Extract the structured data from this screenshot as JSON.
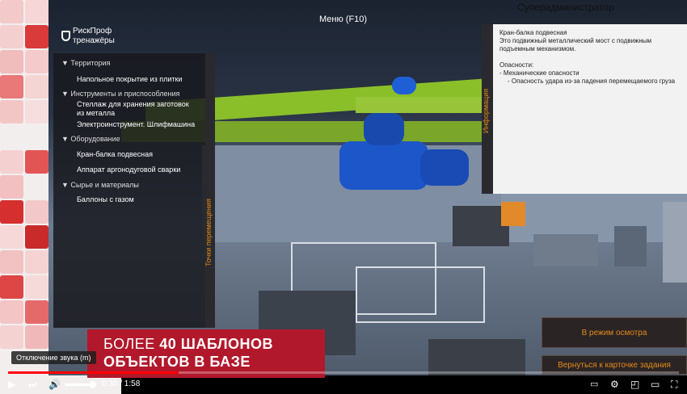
{
  "topbar": {
    "menu_label": "Меню (F10)",
    "admin_label": "Суперадминистратор"
  },
  "logo": {
    "line1": "РискПроф",
    "line2": "тренажёры"
  },
  "left_panel": {
    "strip_label": "Точки перемещения",
    "categories": [
      {
        "label": "Территория",
        "items": [
          "Напольное покрытие из плитки"
        ]
      },
      {
        "label": "Инструменты и приспособления",
        "items": [
          "Стеллаж для хранения заготовок из металла",
          "Электроинструмент. Шлифмашина"
        ]
      },
      {
        "label": "Оборудование",
        "items": [
          "Кран-балка подвесная",
          "Аппарат аргонодуговой сварки"
        ]
      },
      {
        "label": "Сырье и материалы",
        "items": [
          "Баллоны с газом"
        ]
      }
    ]
  },
  "info_panel": {
    "strip_label": "Информация",
    "title": "Кран-балка подвесная",
    "desc": "Это подвижный металлический мост с подвижным подъемным механизмом.",
    "hazards_title": "Опасности:",
    "hazard_1": "- Механические опасности",
    "hazard_2": "- Опасность удара из-за падения перемещаемого груза"
  },
  "promo": {
    "line1_a": "БОЛЕЕ ",
    "line1_b": "40 ШАБЛОНОВ",
    "line2": "ОБЪЕКТОВ В БАЗЕ"
  },
  "buttons": {
    "inspect": "В режим осмотра",
    "back": "Вернуться к карточке задания"
  },
  "player": {
    "tooltip": "Отключение звука (m)",
    "time": "0:30 / 1:58",
    "progress": 0.254,
    "accent": "#ff0000"
  },
  "colors": {
    "brand_red": "#b2182b",
    "accent_orange": "#e08a1c"
  }
}
